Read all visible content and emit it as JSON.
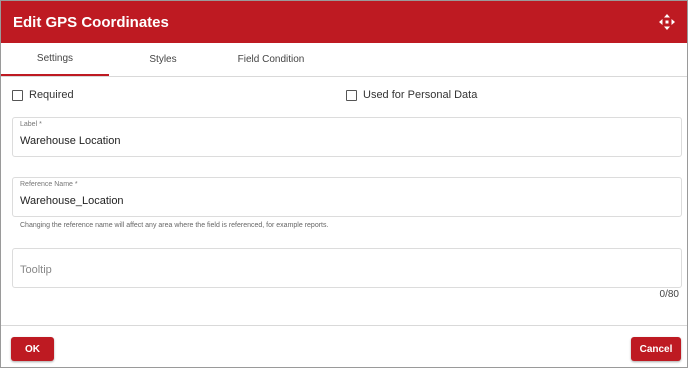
{
  "dialog": {
    "title": "Edit GPS Coordinates",
    "accent_color": "#be1a22"
  },
  "tabs": [
    {
      "label": "Settings",
      "active": true
    },
    {
      "label": "Styles",
      "active": false
    },
    {
      "label": "Field Condition",
      "active": false
    }
  ],
  "settings": {
    "required_label": "Required",
    "required_checked": false,
    "personal_data_label": "Used for Personal Data",
    "personal_data_checked": false,
    "label_field": {
      "label": "Label *",
      "value": "Warehouse Location"
    },
    "reference_field": {
      "label": "Reference Name *",
      "value": "Warehouse_Location"
    },
    "reference_hint": "Changing the reference name will affect any area where the field is referenced, for example reports.",
    "tooltip_field": {
      "placeholder": "Tooltip",
      "value": ""
    },
    "tooltip_counter": "0/80"
  },
  "footer": {
    "ok_label": "OK",
    "cancel_label": "Cancel"
  },
  "icons": {
    "move": "move-arrows-icon"
  }
}
